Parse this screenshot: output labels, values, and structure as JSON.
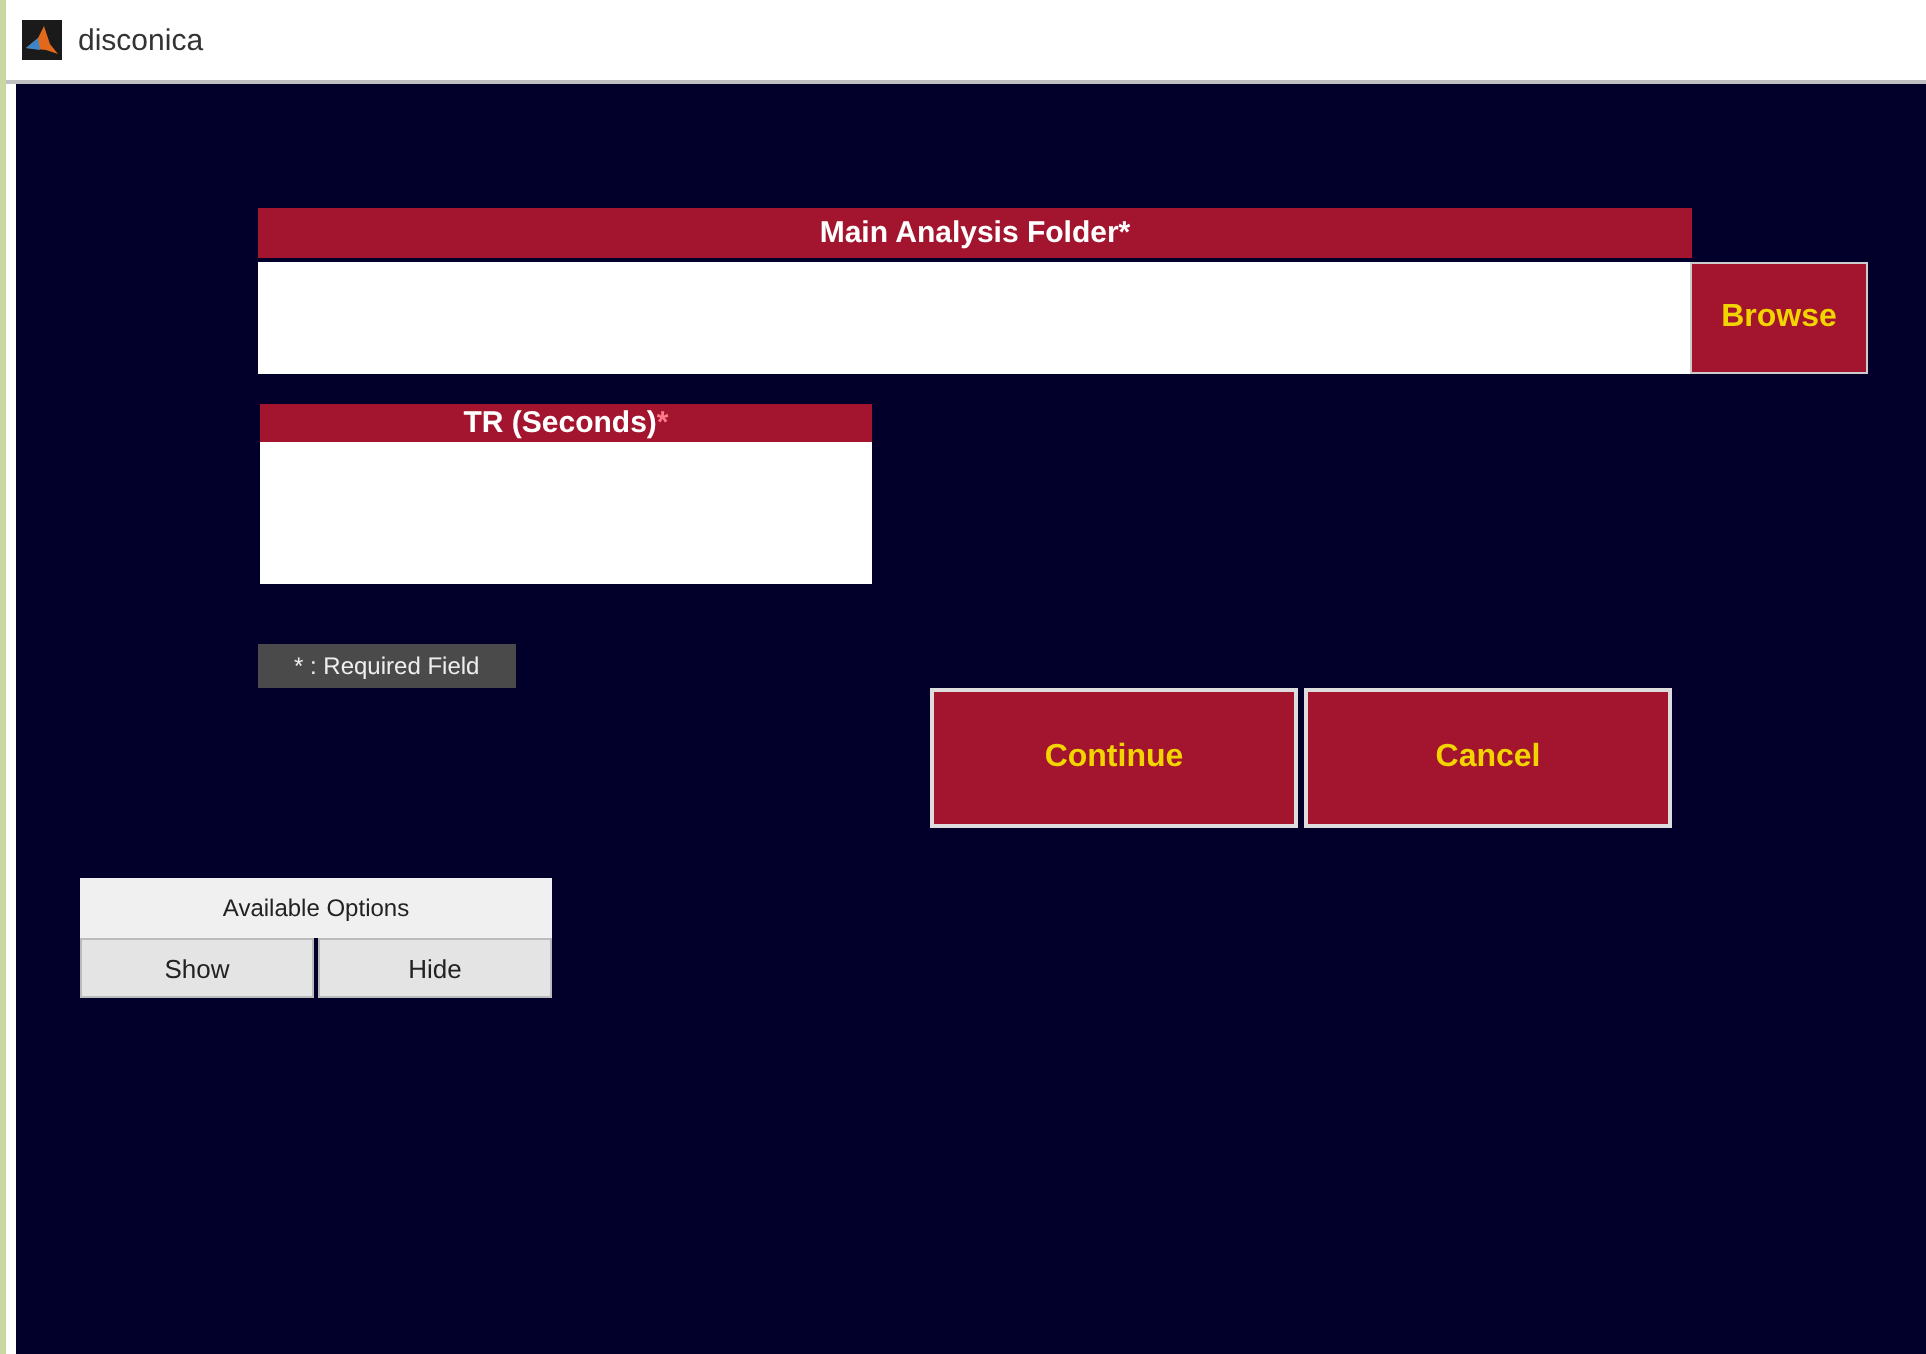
{
  "window": {
    "title": "disconica"
  },
  "main_folder": {
    "label": "Main Analysis Folder*",
    "browse_button": "Browse"
  },
  "tr_field": {
    "label": "TR (Seconds)",
    "required_mark": "*"
  },
  "required_note": "* : Required Field",
  "buttons": [
    "Continue",
    "Cancel"
  ],
  "available_options": {
    "title": "Available Options",
    "buttons": [
      "Show",
      "Hide"
    ]
  }
}
